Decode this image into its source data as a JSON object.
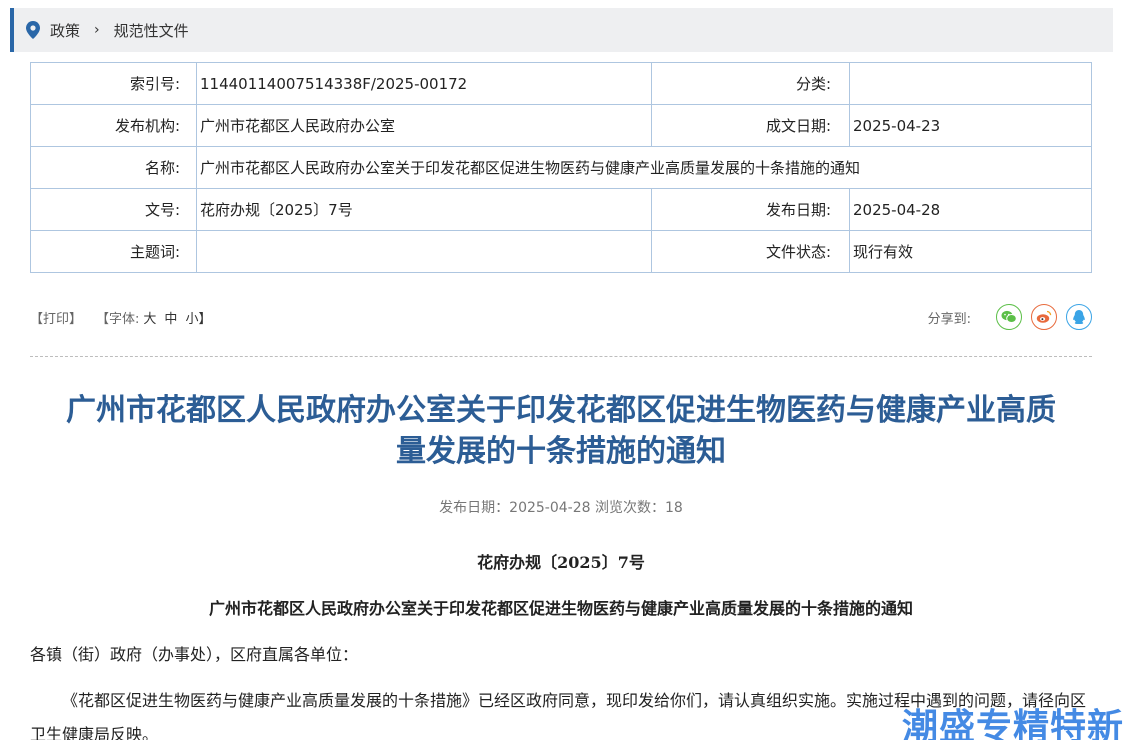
{
  "breadcrumb": {
    "items": [
      "政策",
      "规范性文件"
    ],
    "separator": "›"
  },
  "meta": {
    "index_label": "索引号:",
    "index_value": "11440114007514338F/2025-00172",
    "category_label": "分类:",
    "category_value": "",
    "publisher_label": "发布机构:",
    "publisher_value": "广州市花都区人民政府办公室",
    "written_date_label": "成文日期:",
    "written_date_value": "2025-04-23",
    "name_label": "名称:",
    "name_value": "广州市花都区人民政府办公室关于印发花都区促进生物医药与健康产业高质量发展的十条措施的通知",
    "docno_label": "文号:",
    "docno_value": "花府办规〔2025〕7号",
    "pub_date_label": "发布日期:",
    "pub_date_value": "2025-04-28",
    "subject_label": "主题词:",
    "subject_value": "",
    "status_label": "文件状态:",
    "status_value": "现行有效"
  },
  "toolbar": {
    "print": "【打印】",
    "font_prefix": "【字体:",
    "font_large": "大",
    "font_medium": "中",
    "font_small": "小】",
    "share_label": "分享到:",
    "share_icons": [
      "wechat-icon",
      "weibo-icon",
      "qq-icon"
    ]
  },
  "article": {
    "title_line1": "广州市花都区人民政府办公室关于印发花都区促进生物医药与健康产业高质",
    "title_line2": "量发展的十条措施的通知",
    "pub_info": "发布日期：2025-04-28  浏览次数：18",
    "doc_number": "花府办规〔2025〕7号",
    "subtitle": "广州市花都区人民政府办公室关于印发花都区促进生物医药与健康产业高质量发展的十条措施的通知",
    "salutation": "各镇（街）政府（办事处），区府直属各单位：",
    "paragraph": "《花都区促进生物医药与健康产业高质量发展的十条措施》已经区政府同意，现印发给你们，请认真组织实施。实施过程中遇到的问题，请径向区卫生健康局反映。"
  },
  "watermark": "潮盛专精特新",
  "colors": {
    "accent": "#2a67a8",
    "title": "#2c5d95",
    "border": "#aec6e0",
    "wechat": "#5cbf48",
    "weibo": "#e86a3c",
    "qq": "#3aa4e6"
  }
}
